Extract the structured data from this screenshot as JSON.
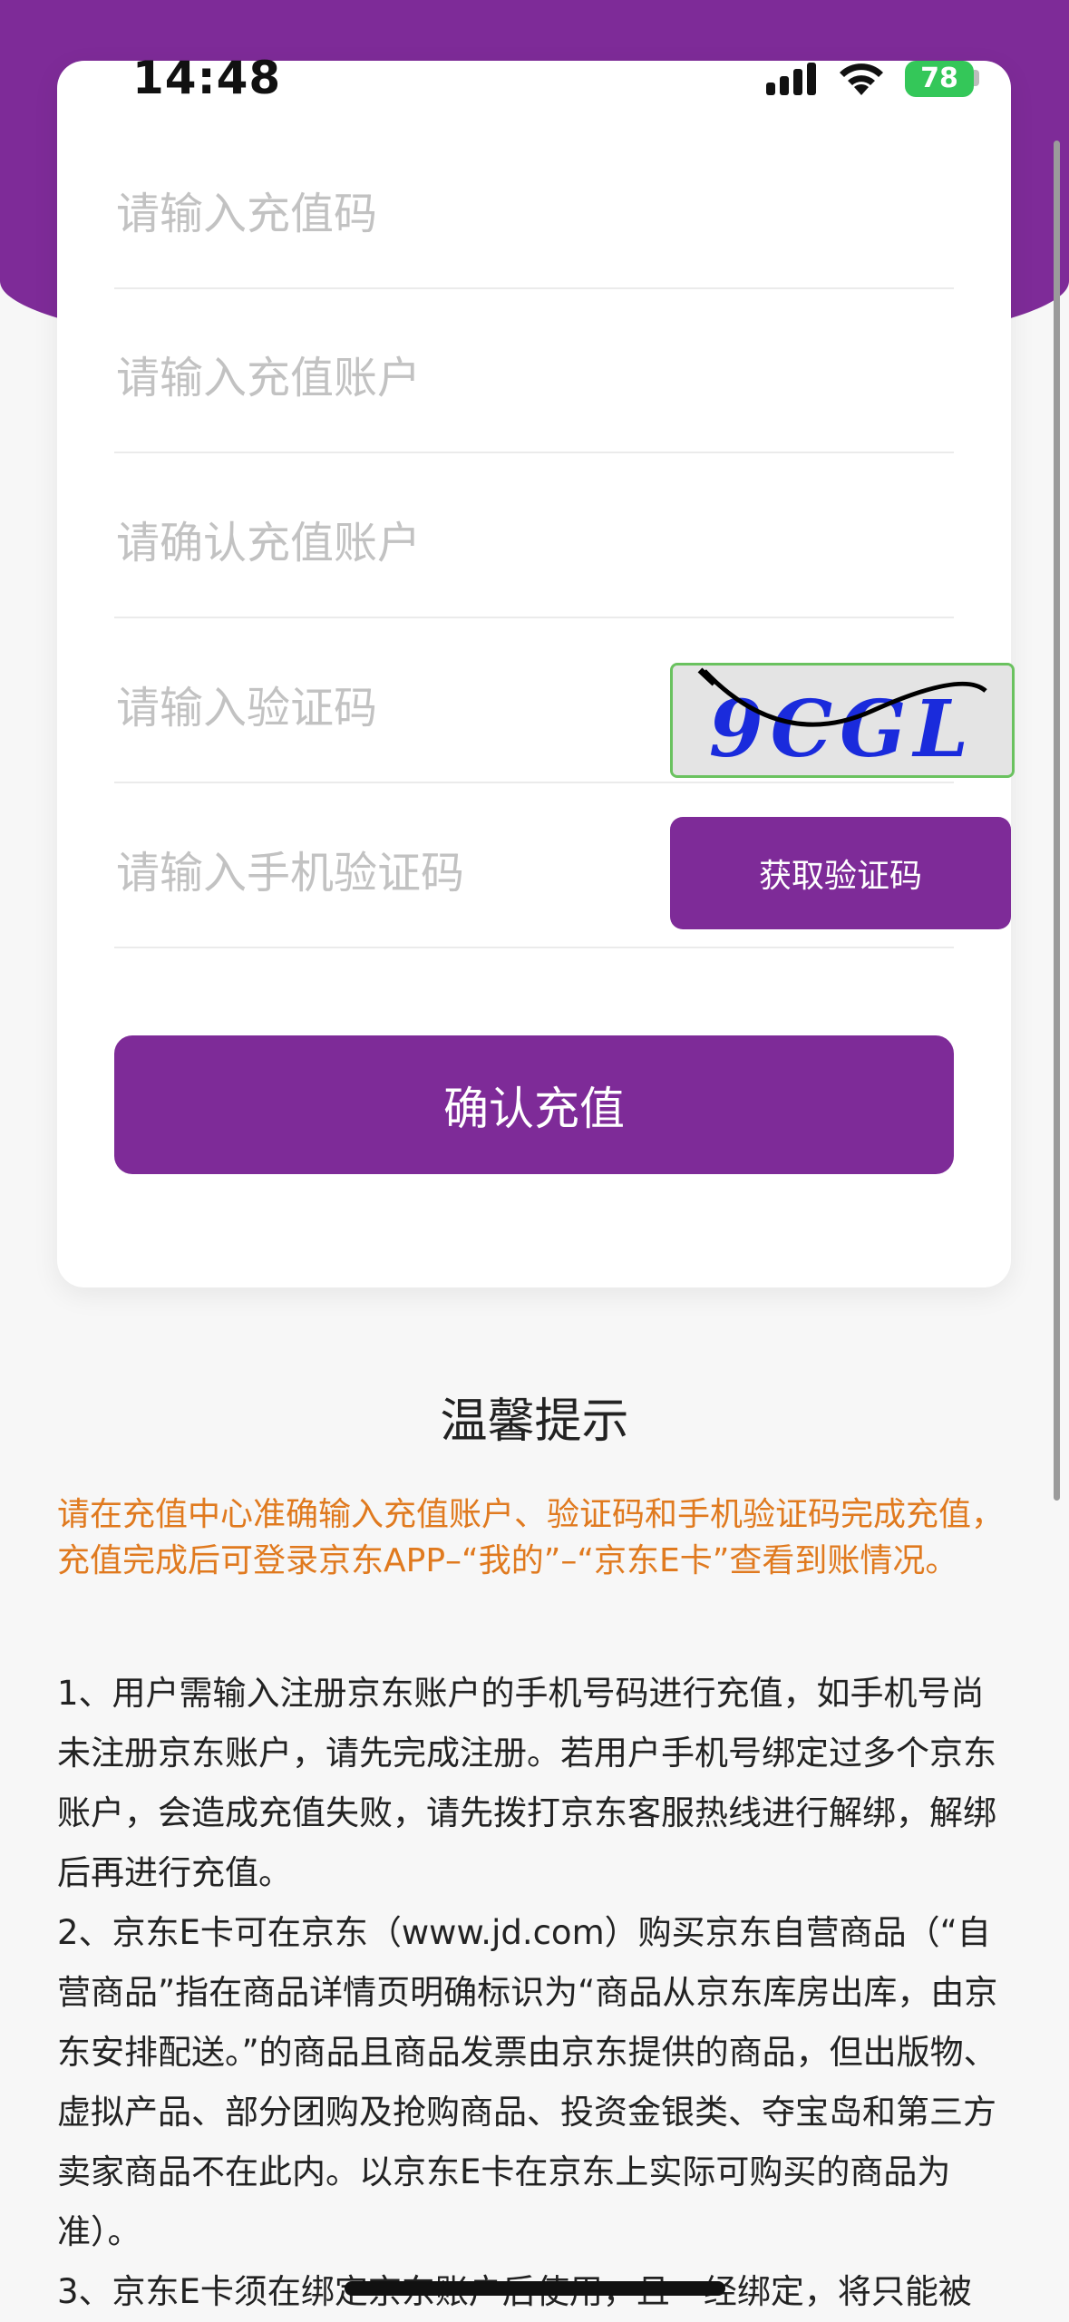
{
  "status_bar": {
    "time": "14:48",
    "battery": "78",
    "icons": [
      "signal-icon",
      "wifi-icon",
      "battery-icon"
    ]
  },
  "form": {
    "recharge_code_placeholder": "请输入充值码",
    "account_placeholder": "请输入充值账户",
    "confirm_account_placeholder": "请确认充值账户",
    "captcha_placeholder": "请输入验证码",
    "captcha_text": "9CGL",
    "sms_placeholder": "请输入手机验证码",
    "get_code_label": "获取验证码",
    "confirm_label": "确认充值"
  },
  "tips": {
    "title": "温馨提示",
    "notice": "请在充值中心准确输入充值账户、验证码和手机验证码完成充值，充值完成后可登录京东APP–“我的”–“京东E卡”查看到账情况。",
    "rules": [
      "1、用户需输入注册京东账户的手机号码进行充值，如手机号尚未注册京东账户，请先完成注册。若用户手机号绑定过多个京东账户，会造成充值失败，请先拨打京东客服热线进行解绑，解绑后再进行充值。",
      "2、京东E卡可在京东（www.jd.com）购买京东自营商品（“自营商品”指在商品详情页明确标识为“商品从京东库房出库，由京东安排配送。”的商品且商品发票由京东提供的商品，但出版物、虚拟产品、部分团购及抢购商品、投资金银类、夺宝岛和第三方卖家商品不在此内。以京东E卡在京东上实际可购买的商品为准）。",
      "3、京东E卡须在绑定京东账户后使用，且一经绑定，将只能被"
    ]
  },
  "colors": {
    "brand_purple": "#7e2b98",
    "notice_orange": "#e07a1f",
    "battery_green": "#34c759"
  }
}
